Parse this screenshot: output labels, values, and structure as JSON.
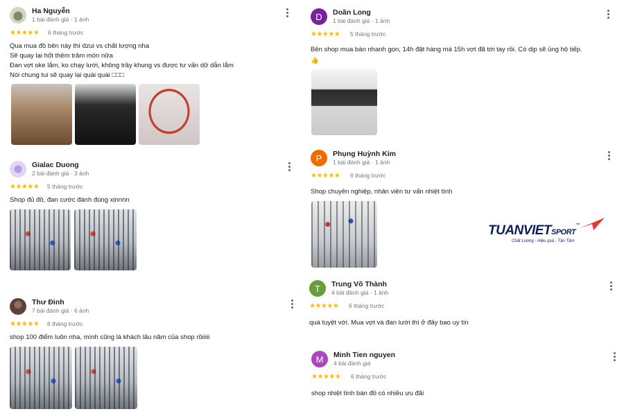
{
  "reviews": [
    {
      "name": "Ha Nguyễn",
      "meta": "1 bài đánh giá · 1 ảnh",
      "stars": "★★★★★",
      "time": "6 tháng trước",
      "lines": [
        "Qua mua đồ bên này thì dzui vs chất lượng nha",
        "Sẽ quay lại hốt thêm trăm món nữa",
        "Đan vợt oke lắm, ko chạy lưới, không trầy khung vs được tư vấn dữ dẫn lắm",
        "Nói chung tui sẽ quay lại quài quài □□□"
      ]
    },
    {
      "name": "Gialac Duong",
      "meta": "2 bài đánh giá · 3 ảnh",
      "stars": "★★★★★",
      "time": "5 tháng trước",
      "lines": [
        "Shop đủ đồ, đan cước đánh đúng xịnnnn"
      ]
    },
    {
      "name": "Thư Đinh",
      "meta": "7 bài đánh giá · 6 ảnh",
      "stars": "★★★★★",
      "time": "6 tháng trước",
      "lines": [
        "shop 100 điểm luôn nha, mình cũng là khách lâu năm của shop rồiiiii"
      ]
    },
    {
      "name": "Doãn Long",
      "initial": "D",
      "color": "#7b1fa2",
      "meta": "1 bài đánh giá · 1 ảnh",
      "stars": "★★★★★",
      "time": "5 tháng trước",
      "lines": [
        "Bên shop mua bán nhanh gọn, 14h đặt hàng mà 15h vợt đã tới tay rồi. Có dịp sẽ ủng hộ tiếp.",
        "👍"
      ]
    },
    {
      "name": "Phụng Huỳnh Kim",
      "initial": "P",
      "color": "#ef6c00",
      "meta": "1 bài đánh giá · 1 ảnh",
      "stars": "★★★★★",
      "time": "6 tháng trước",
      "lines": [
        "Shop chuyên nghiệp, nhân viên tư vấn nhiệt tình"
      ]
    },
    {
      "name": "Trung Võ Thành",
      "initial": "T",
      "color": "#689f38",
      "meta": "4 bài đánh giá · 1 ảnh",
      "stars": "★★★★★",
      "time": "6 tháng trước",
      "lines": [
        "quá tuyệt vời. Mua vợt và đan lưới thì ở đây bao uy tín"
      ]
    },
    {
      "name": "Minh Tien nguyen",
      "initial": "M",
      "color": "#ab47bc",
      "meta": "4 bài đánh giá",
      "stars": "★★★★★",
      "time": "6 tháng trước",
      "lines": [
        "shop nhiệt tình bán đồ có nhiều ưu đãi"
      ]
    }
  ],
  "logo": {
    "brand": "TUANVIET",
    "sport": "SPORT",
    "tm": "™",
    "tagline": "Chất Lượng - Hiệu quả - Tận Tâm",
    "color": "#0d1f5c",
    "accent": "#e53935"
  },
  "icons": {
    "more": "more-vert-icon",
    "star": "star-icon"
  },
  "colors": {
    "star": "#fbbc04",
    "muted": "#70757a"
  }
}
